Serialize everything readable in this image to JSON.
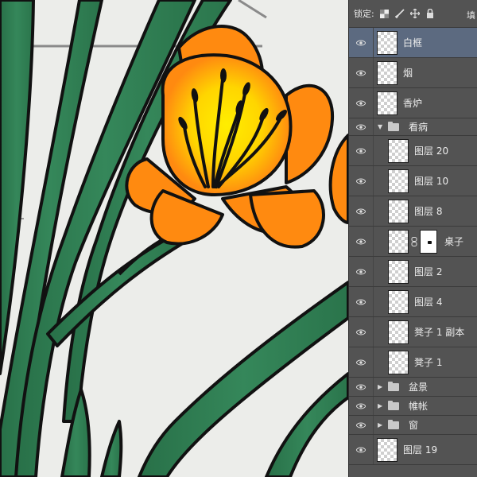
{
  "lockbar": {
    "lock_label": "锁定:",
    "fill_label": "填",
    "icons": [
      "lock-transparent-icon",
      "lock-paint-icon",
      "lock-move-icon",
      "lock-all-icon"
    ]
  },
  "layers": [
    {
      "name": "白框",
      "selected": true
    },
    {
      "name": "烟"
    },
    {
      "name": "香炉"
    },
    {
      "name": "看病",
      "group": true,
      "expanded": true
    },
    {
      "name": "图层 20"
    },
    {
      "name": "图层 10"
    },
    {
      "name": "图层 8"
    },
    {
      "name": "桌子",
      "has_mask": true
    },
    {
      "name": "图层 2"
    },
    {
      "name": "图层 4"
    },
    {
      "name": "凳子 1 副本"
    },
    {
      "name": "凳子 1"
    },
    {
      "name": "盆景",
      "group": true,
      "expanded": false
    },
    {
      "name": "帷帐",
      "group": true,
      "expanded": false
    },
    {
      "name": "窗",
      "group": true,
      "expanded": false
    },
    {
      "name": "图层 19"
    }
  ],
  "colors": {
    "panel_bg": "#535353",
    "selected_row": "#5c6a80",
    "leaf_green": "#2e7d4f",
    "petal_orange": "#ff8a10",
    "center_yellow": "#ffe500",
    "canvas_bg": "#ecedea"
  }
}
